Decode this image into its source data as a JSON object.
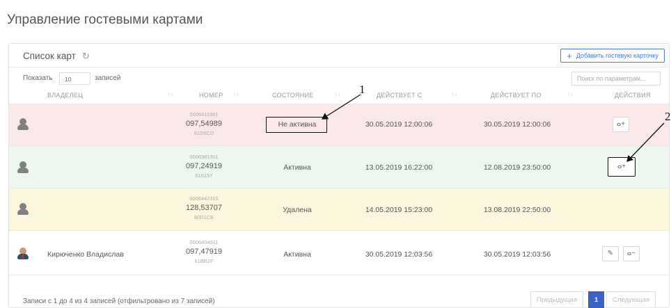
{
  "page": {
    "title": "Управление гостевыми картами"
  },
  "panel": {
    "title": "Список карт",
    "refresh_icon": "refresh-icon",
    "add_button": "Добавить гостевую карточку",
    "show_label": "Показать",
    "entries_value": "10",
    "entries_label": "записей",
    "search_placeholder": "Поиск по параметрам..."
  },
  "columns": [
    "ВЛАДЕЛЕЦ",
    "НОМЕР",
    "СОСТОЯНИЕ",
    "ДЕЙСТВУЕТ С",
    "ДЕЙСТВУЕТ ПО",
    "ДЕЙСТВИЯ"
  ],
  "rows": [
    {
      "owner": "",
      "num1": "0006411981",
      "num2": "097,54989",
      "num3": "61D6CD",
      "status": "Не активна",
      "from": "30.05.2019 12:00:06",
      "to": "30.05.2019 12:00:06",
      "color": "#fbe9ea"
    },
    {
      "owner": "",
      "num1": "0006381911",
      "num2": "097,24919",
      "num3": "616157",
      "status": "Активна",
      "from": "13.05.2019 16:22:00",
      "to": "12.08.2019 23:50:00",
      "color": "#eef7ef"
    },
    {
      "owner": "",
      "num1": "0008442315",
      "num2": "128,53707",
      "num3": "80D1CB",
      "status": "Удалена",
      "from": "14.05.2019 15:23:00",
      "to": "13.08.2019 22:50:00",
      "color": "#fcf6dc"
    },
    {
      "owner": "Кирюченко Владислав",
      "num1": "0006404911",
      "num2": "097,47919",
      "num3": "61BB2F",
      "status": "Активна",
      "from": "30.05.2019 12:03:56",
      "to": "30.05.2019 12:03:56",
      "color": "#ffffff"
    }
  ],
  "footer": {
    "info": "Записи с 1 до 4 из 4 записей (отфильтровано из 7 записей)",
    "prev": "Предыдущая",
    "page": "1",
    "next": "Следующая"
  },
  "callouts": [
    "1",
    "2"
  ]
}
